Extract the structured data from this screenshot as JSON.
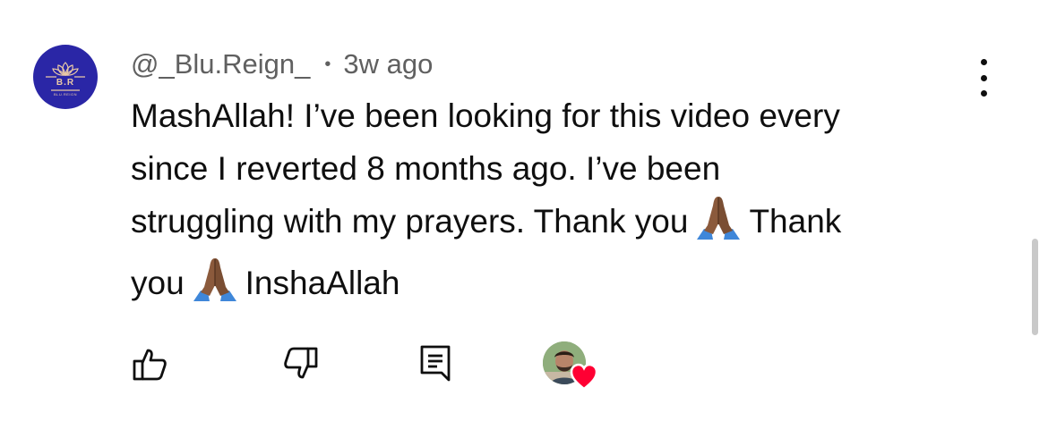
{
  "comment": {
    "author": "@_Blu.Reign_",
    "separator": "•",
    "time_ago": "3w ago",
    "avatar": {
      "initials": "B.R",
      "color": "#2a26a6",
      "tagline": "BLU.REIGN"
    },
    "lines": [
      "MashAllah! I’ve been looking for this video every",
      "since I reverted 8 months ago. I’ve been",
      "struggling with my prayers. Thank you",
      "Thank",
      "you",
      "InshaAllah"
    ]
  },
  "icons": {
    "more": "more-vertical-icon",
    "like": "thumbs-up-icon",
    "dislike": "thumbs-down-icon",
    "reply": "reply-comment-icon",
    "emoji": "folded-hands-icon",
    "creator_heart": "heart-icon"
  },
  "colors": {
    "text": "#0f0f0f",
    "meta": "#606060",
    "heart": "#ff0033",
    "avatar_bg": "#2a26a6"
  }
}
